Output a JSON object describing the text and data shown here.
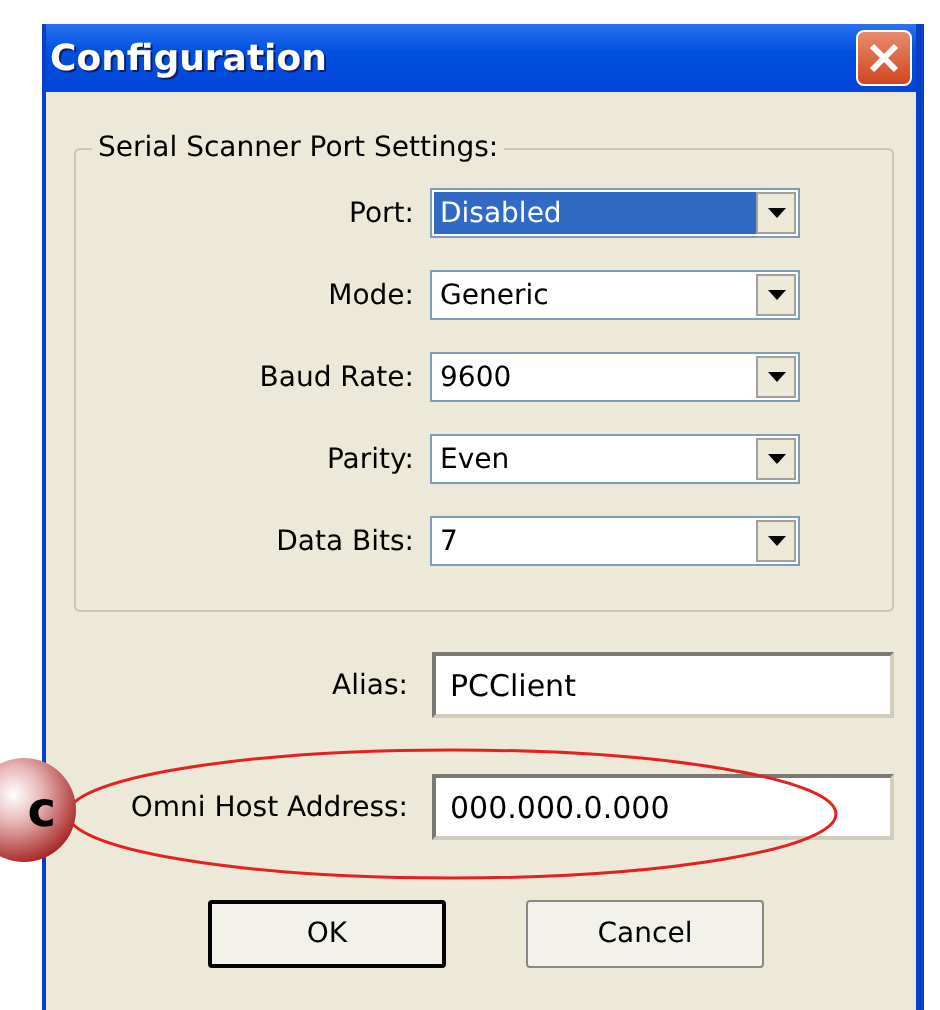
{
  "window": {
    "title": "Configuration"
  },
  "group": {
    "title": "Serial Scanner Port Settings:",
    "fields": [
      {
        "label": "Port:",
        "value": "Disabled",
        "selected": true
      },
      {
        "label": "Mode:",
        "value": "Generic",
        "selected": false
      },
      {
        "label": "Baud Rate:",
        "value": "9600",
        "selected": false
      },
      {
        "label": "Parity:",
        "value": "Even",
        "selected": false
      },
      {
        "label": "Data Bits:",
        "value": "7",
        "selected": false
      }
    ]
  },
  "alias": {
    "label": "Alias:",
    "value": "PCClient"
  },
  "host": {
    "label": "Omni Host Address:",
    "value": "000.000.0.000"
  },
  "callout": {
    "label": "c"
  },
  "buttons": [
    {
      "label": "OK",
      "default": true
    },
    {
      "label": "Cancel",
      "default": false
    }
  ]
}
